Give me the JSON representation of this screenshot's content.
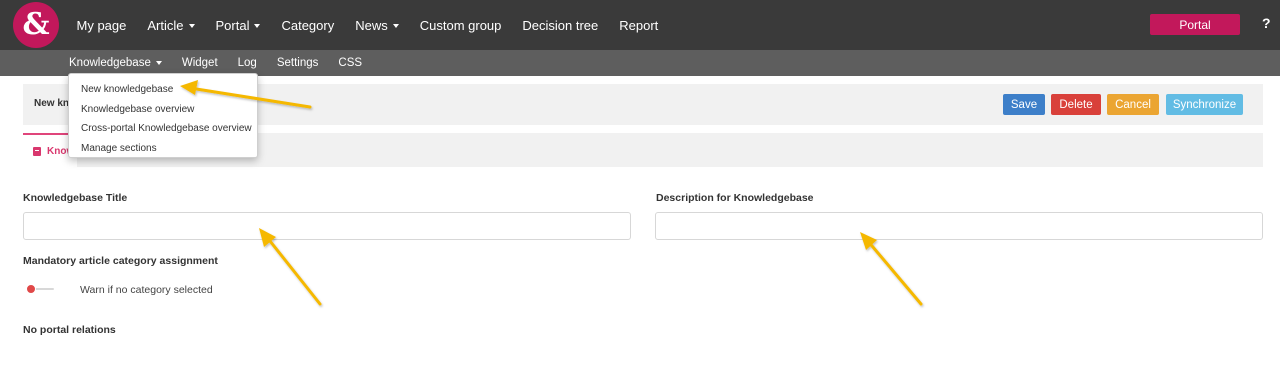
{
  "logo": "&",
  "main_nav": [
    {
      "label": "My page",
      "has_caret": false
    },
    {
      "label": "Article",
      "has_caret": true
    },
    {
      "label": "Portal",
      "has_caret": true
    },
    {
      "label": "Category",
      "has_caret": false
    },
    {
      "label": "News",
      "has_caret": true
    },
    {
      "label": "Custom group",
      "has_caret": false
    },
    {
      "label": "Decision tree",
      "has_caret": false
    },
    {
      "label": "Report",
      "has_caret": false
    }
  ],
  "portal_button": "Portal",
  "help_icon": "?",
  "sub_nav": [
    {
      "label": "Knowledgebase",
      "has_caret": true,
      "active": true
    },
    {
      "label": "Widget",
      "has_caret": false,
      "active": false
    },
    {
      "label": "Log",
      "has_caret": false,
      "active": false
    },
    {
      "label": "Settings",
      "has_caret": false,
      "active": false
    },
    {
      "label": "CSS",
      "has_caret": false,
      "active": false
    }
  ],
  "dropdown_items": [
    "New knowledgebase",
    "Knowledgebase overview",
    "Cross-portal Knowledgebase overview",
    "Manage sections"
  ],
  "toolbar": {
    "title": "New kn",
    "save": "Save",
    "delete": "Delete",
    "cancel": "Cancel",
    "synchronize": "Synchronize"
  },
  "tab_label": "Know",
  "form": {
    "title_label": "Knowledgebase Title",
    "title_value": "",
    "description_label": "Description for Knowledgebase",
    "description_value": "",
    "mandatory_label": "Mandatory article category assignment",
    "toggle_label": "Warn if no category selected",
    "toggle_on": false,
    "portal_relations": "No portal relations"
  },
  "colors": {
    "brand": "#c2185b",
    "annotation_arrow": "#f5b800",
    "save": "#3d7fc9",
    "delete": "#d9403a",
    "cancel": "#eba532",
    "synchronize": "#62bce4"
  }
}
